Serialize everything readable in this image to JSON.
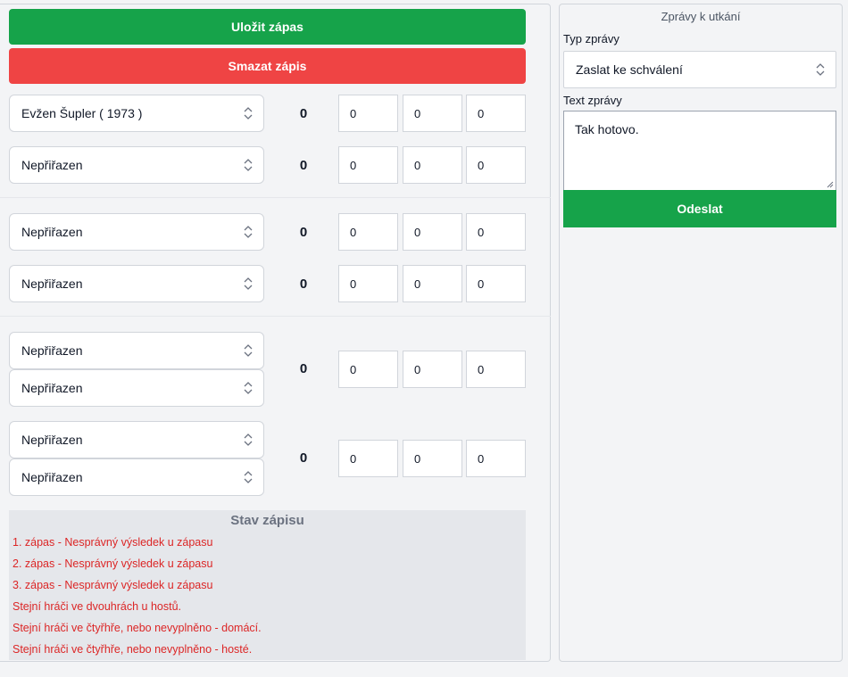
{
  "actions": {
    "save_label": "Uložit zápas",
    "delete_label": "Smazat zápis"
  },
  "matches": [
    {
      "rows": [
        {
          "player": "Evžen Šupler ( 1973 )",
          "score": "0",
          "sets": [
            "0",
            "0",
            "0"
          ]
        },
        {
          "player": "Nepřiřazen",
          "score": "0",
          "sets": [
            "0",
            "0",
            "0"
          ]
        }
      ]
    },
    {
      "rows": [
        {
          "player": "Nepřiřazen",
          "score": "0",
          "sets": [
            "0",
            "0",
            "0"
          ]
        },
        {
          "player": "Nepřiřazen",
          "score": "0",
          "sets": [
            "0",
            "0",
            "0"
          ]
        }
      ]
    },
    {
      "pairs": [
        {
          "players": [
            "Nepřiřazen",
            "Nepřiřazen"
          ],
          "score": "0",
          "sets": [
            "0",
            "0",
            "0"
          ]
        },
        {
          "players": [
            "Nepřiřazen",
            "Nepřiřazen"
          ],
          "score": "0",
          "sets": [
            "0",
            "0",
            "0"
          ]
        }
      ]
    }
  ],
  "status": {
    "title": "Stav zápisu",
    "items": [
      "1. zápas - Nesprávný výsledek u zápasu",
      "2. zápas - Nesprávný výsledek u zápasu",
      "3. zápas - Nesprávný výsledek u zápasu",
      "Stejní hráči ve dvouhrách u hostů.",
      "Stejní hráči ve čtyřhře, nebo nevyplněno - domácí.",
      "Stejní hráči ve čtyřhře, nebo nevyplněno - hosté."
    ],
    "error_color": "#dc2626"
  },
  "messages": {
    "title": "Zprávy k utkání",
    "type_label": "Typ zprávy",
    "type_value": "Zaslat ke schválení",
    "text_label": "Text zprávy",
    "text_value": "Tak hotovo.",
    "send_label": "Odeslat"
  },
  "colors": {
    "primary": "#16a34a",
    "danger": "#ef4444"
  },
  "icons": [
    "chevron-updown-icon",
    "resize-grip-icon"
  ]
}
